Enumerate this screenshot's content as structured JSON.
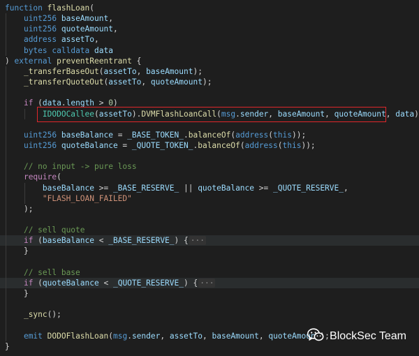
{
  "colors": {
    "background": "#1e1e1e",
    "text": "#d4d4d4",
    "keyword": "#569cd6",
    "control": "#c586c0",
    "function": "#dcdcaa",
    "type": "#4ec9b0",
    "variable": "#9cdcfe",
    "string": "#ce9178",
    "number": "#b5cea8",
    "comment": "#6a9955",
    "highlight_box": "#e0272b"
  },
  "code_lines": [
    [
      [
        "function",
        "keyword"
      ],
      [
        " ",
        "text"
      ],
      [
        "flashLoan",
        "function"
      ],
      [
        "(",
        "text"
      ]
    ],
    [
      [
        "    ",
        "text"
      ],
      [
        "uint256",
        "keyword"
      ],
      [
        " ",
        "text"
      ],
      [
        "baseAmount",
        "variable"
      ],
      [
        ",",
        "text"
      ]
    ],
    [
      [
        "    ",
        "text"
      ],
      [
        "uint256",
        "keyword"
      ],
      [
        " ",
        "text"
      ],
      [
        "quoteAmount",
        "variable"
      ],
      [
        ",",
        "text"
      ]
    ],
    [
      [
        "    ",
        "text"
      ],
      [
        "address",
        "keyword"
      ],
      [
        " ",
        "text"
      ],
      [
        "assetTo",
        "variable"
      ],
      [
        ",",
        "text"
      ]
    ],
    [
      [
        "    ",
        "text"
      ],
      [
        "bytes",
        "keyword"
      ],
      [
        " ",
        "text"
      ],
      [
        "calldata",
        "keyword"
      ],
      [
        " ",
        "text"
      ],
      [
        "data",
        "variable"
      ]
    ],
    [
      [
        ") ",
        "text"
      ],
      [
        "external",
        "keyword"
      ],
      [
        " ",
        "text"
      ],
      [
        "preventReentrant",
        "function"
      ],
      [
        " {",
        "text"
      ]
    ],
    [
      [
        "    ",
        "text"
      ],
      [
        "_transferBaseOut",
        "function"
      ],
      [
        "(",
        "text"
      ],
      [
        "assetTo",
        "variable"
      ],
      [
        ", ",
        "text"
      ],
      [
        "baseAmount",
        "variable"
      ],
      [
        ");",
        "text"
      ]
    ],
    [
      [
        "    ",
        "text"
      ],
      [
        "_transferQuoteOut",
        "function"
      ],
      [
        "(",
        "text"
      ],
      [
        "assetTo",
        "variable"
      ],
      [
        ", ",
        "text"
      ],
      [
        "quoteAmount",
        "variable"
      ],
      [
        ");",
        "text"
      ]
    ],
    [],
    [
      [
        "    ",
        "text"
      ],
      [
        "if",
        "control"
      ],
      [
        " (",
        "text"
      ],
      [
        "data",
        "variable"
      ],
      [
        ".",
        "text"
      ],
      [
        "length",
        "variable"
      ],
      [
        " > ",
        "text"
      ],
      [
        "0",
        "number"
      ],
      [
        ")",
        "text"
      ]
    ],
    [
      [
        "        ",
        "text"
      ],
      [
        "IDODOCallee",
        "type"
      ],
      [
        "(",
        "text"
      ],
      [
        "assetTo",
        "variable"
      ],
      [
        ").",
        "text"
      ],
      [
        "DVMFlashLoanCall",
        "function"
      ],
      [
        "(",
        "text"
      ],
      [
        "msg",
        "keyword"
      ],
      [
        ".",
        "text"
      ],
      [
        "sender",
        "variable"
      ],
      [
        ", ",
        "text"
      ],
      [
        "baseAmount",
        "variable"
      ],
      [
        ", ",
        "text"
      ],
      [
        "quoteAmount",
        "variable"
      ],
      [
        ", ",
        "text"
      ],
      [
        "data",
        "variable"
      ],
      [
        ");",
        "text"
      ]
    ],
    [],
    [
      [
        "    ",
        "text"
      ],
      [
        "uint256",
        "keyword"
      ],
      [
        " ",
        "text"
      ],
      [
        "baseBalance",
        "variable"
      ],
      [
        " = ",
        "text"
      ],
      [
        "_BASE_TOKEN_",
        "variable"
      ],
      [
        ".",
        "text"
      ],
      [
        "balanceOf",
        "function"
      ],
      [
        "(",
        "text"
      ],
      [
        "address",
        "keyword"
      ],
      [
        "(",
        "text"
      ],
      [
        "this",
        "keyword"
      ],
      [
        "));",
        "text"
      ]
    ],
    [
      [
        "    ",
        "text"
      ],
      [
        "uint256",
        "keyword"
      ],
      [
        " ",
        "text"
      ],
      [
        "quoteBalance",
        "variable"
      ],
      [
        " = ",
        "text"
      ],
      [
        "_QUOTE_TOKEN_",
        "variable"
      ],
      [
        ".",
        "text"
      ],
      [
        "balanceOf",
        "function"
      ],
      [
        "(",
        "text"
      ],
      [
        "address",
        "keyword"
      ],
      [
        "(",
        "text"
      ],
      [
        "this",
        "keyword"
      ],
      [
        "));",
        "text"
      ]
    ],
    [],
    [
      [
        "    ",
        "text"
      ],
      [
        "// no input -> pure loss",
        "comment"
      ]
    ],
    [
      [
        "    ",
        "text"
      ],
      [
        "require",
        "control"
      ],
      [
        "(",
        "text"
      ]
    ],
    [
      [
        "        ",
        "text"
      ],
      [
        "baseBalance",
        "variable"
      ],
      [
        " >= ",
        "text"
      ],
      [
        "_BASE_RESERVE_",
        "variable"
      ],
      [
        " || ",
        "text"
      ],
      [
        "quoteBalance",
        "variable"
      ],
      [
        " >= ",
        "text"
      ],
      [
        "_QUOTE_RESERVE_",
        "variable"
      ],
      [
        ",",
        "text"
      ]
    ],
    [
      [
        "        ",
        "text"
      ],
      [
        "\"FLASH_LOAN_FAILED\"",
        "string"
      ]
    ],
    [
      [
        "    ",
        "text"
      ],
      [
        ");",
        "text"
      ]
    ],
    [],
    [
      [
        "    ",
        "text"
      ],
      [
        "// sell quote",
        "comment"
      ]
    ],
    [
      [
        "    ",
        "text"
      ],
      [
        "if",
        "control"
      ],
      [
        " (",
        "text"
      ],
      [
        "baseBalance",
        "variable"
      ],
      [
        " < ",
        "text"
      ],
      [
        "_BASE_RESERVE_",
        "variable"
      ],
      [
        ") {",
        "text"
      ],
      [
        "···",
        "fold"
      ]
    ],
    [
      [
        "    ",
        "text"
      ],
      [
        "}",
        "text"
      ]
    ],
    [],
    [
      [
        "    ",
        "text"
      ],
      [
        "// sell base",
        "comment"
      ]
    ],
    [
      [
        "    ",
        "text"
      ],
      [
        "if",
        "control"
      ],
      [
        " (",
        "text"
      ],
      [
        "quoteBalance",
        "variable"
      ],
      [
        " < ",
        "text"
      ],
      [
        "_QUOTE_RESERVE_",
        "variable"
      ],
      [
        ") {",
        "text"
      ],
      [
        "···",
        "fold"
      ]
    ],
    [
      [
        "    ",
        "text"
      ],
      [
        "}",
        "text"
      ]
    ],
    [],
    [
      [
        "    ",
        "text"
      ],
      [
        "_sync",
        "function"
      ],
      [
        "();",
        "text"
      ]
    ],
    [],
    [
      [
        "    ",
        "text"
      ],
      [
        "emit",
        "keyword"
      ],
      [
        " ",
        "text"
      ],
      [
        "DODOFlashLoan",
        "function"
      ],
      [
        "(",
        "text"
      ],
      [
        "msg",
        "keyword"
      ],
      [
        ".",
        "text"
      ],
      [
        "sender",
        "variable"
      ],
      [
        ", ",
        "text"
      ],
      [
        "assetTo",
        "variable"
      ],
      [
        ", ",
        "text"
      ],
      [
        "baseAmount",
        "variable"
      ],
      [
        ", ",
        "text"
      ],
      [
        "quoteAmount",
        "variable"
      ],
      [
        ");",
        "text"
      ]
    ],
    [
      [
        "}",
        "text"
      ]
    ]
  ],
  "highlighted_line_indexes": [
    22,
    26
  ],
  "red_box_line_index": 10,
  "watermark": {
    "icon": "wechat-icon",
    "text": "BlockSec Team"
  }
}
